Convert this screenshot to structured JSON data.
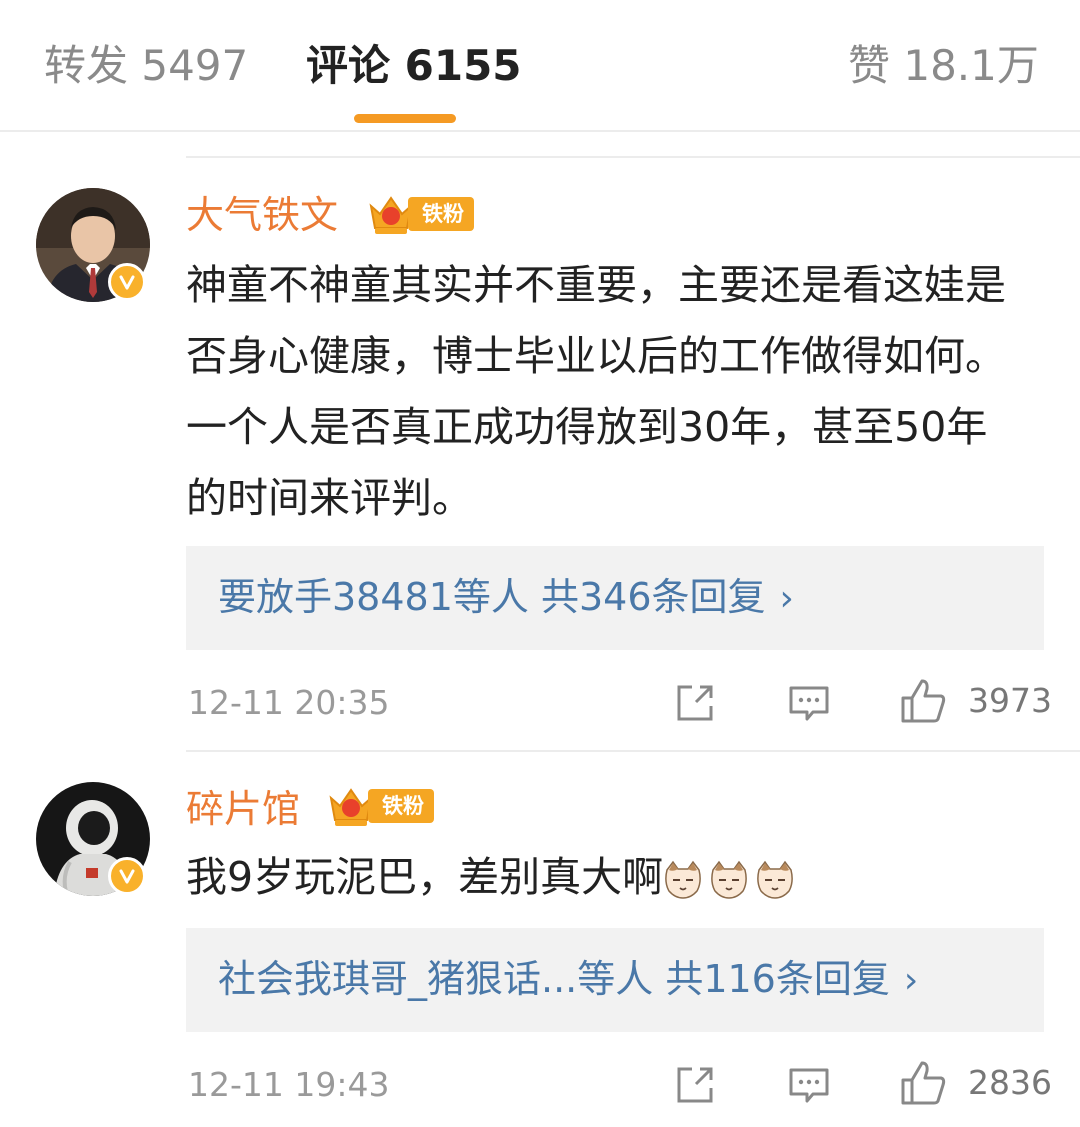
{
  "tabs": {
    "repost": "转发 5497",
    "comments": "评论 6155",
    "likes": "赞 18.1万"
  },
  "colors": {
    "accent": "#f59a23",
    "username": "#eb7b35",
    "link": "#4a78a8",
    "badge": "#f5a623"
  },
  "comments": [
    {
      "username": "大气铁文",
      "fan_badge": "铁粉",
      "text": "神童不神童其实并不重要，主要还是看这娃是否身心健康，博士毕业以后的工作做得如何。一个人是否真正成功得放到30年，甚至50年的时间来评判。",
      "reply_summary": "要放手38481等人  共346条回复",
      "chevron": "›",
      "timestamp": "12-11 20:35",
      "likes": "3973",
      "icons": [
        "share-icon",
        "comment-icon",
        "thumbs-up-icon"
      ]
    },
    {
      "username": "碎片馆",
      "fan_badge": "铁粉",
      "text": "我9岁玩泥巴，差别真大啊",
      "emoji": [
        "cat-emoji-icon",
        "cat-emoji-icon",
        "cat-emoji-icon"
      ],
      "reply_summary": "社会我琪哥_猪狠话...等人  共116条回复",
      "chevron": "›",
      "timestamp": "12-11 19:43",
      "likes": "2836",
      "icons": [
        "share-icon",
        "comment-icon",
        "thumbs-up-icon"
      ]
    }
  ]
}
